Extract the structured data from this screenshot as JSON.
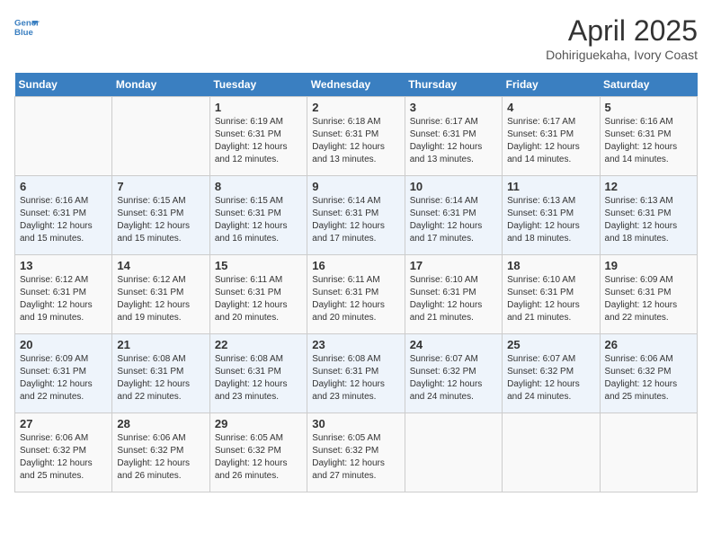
{
  "header": {
    "logo_line1": "General",
    "logo_line2": "Blue",
    "month_title": "April 2025",
    "subtitle": "Dohiriguekaha, Ivory Coast"
  },
  "days_of_week": [
    "Sunday",
    "Monday",
    "Tuesday",
    "Wednesday",
    "Thursday",
    "Friday",
    "Saturday"
  ],
  "weeks": [
    [
      {
        "num": "",
        "info": ""
      },
      {
        "num": "",
        "info": ""
      },
      {
        "num": "1",
        "info": "Sunrise: 6:19 AM\nSunset: 6:31 PM\nDaylight: 12 hours and 12 minutes."
      },
      {
        "num": "2",
        "info": "Sunrise: 6:18 AM\nSunset: 6:31 PM\nDaylight: 12 hours and 13 minutes."
      },
      {
        "num": "3",
        "info": "Sunrise: 6:17 AM\nSunset: 6:31 PM\nDaylight: 12 hours and 13 minutes."
      },
      {
        "num": "4",
        "info": "Sunrise: 6:17 AM\nSunset: 6:31 PM\nDaylight: 12 hours and 14 minutes."
      },
      {
        "num": "5",
        "info": "Sunrise: 6:16 AM\nSunset: 6:31 PM\nDaylight: 12 hours and 14 minutes."
      }
    ],
    [
      {
        "num": "6",
        "info": "Sunrise: 6:16 AM\nSunset: 6:31 PM\nDaylight: 12 hours and 15 minutes."
      },
      {
        "num": "7",
        "info": "Sunrise: 6:15 AM\nSunset: 6:31 PM\nDaylight: 12 hours and 15 minutes."
      },
      {
        "num": "8",
        "info": "Sunrise: 6:15 AM\nSunset: 6:31 PM\nDaylight: 12 hours and 16 minutes."
      },
      {
        "num": "9",
        "info": "Sunrise: 6:14 AM\nSunset: 6:31 PM\nDaylight: 12 hours and 17 minutes."
      },
      {
        "num": "10",
        "info": "Sunrise: 6:14 AM\nSunset: 6:31 PM\nDaylight: 12 hours and 17 minutes."
      },
      {
        "num": "11",
        "info": "Sunrise: 6:13 AM\nSunset: 6:31 PM\nDaylight: 12 hours and 18 minutes."
      },
      {
        "num": "12",
        "info": "Sunrise: 6:13 AM\nSunset: 6:31 PM\nDaylight: 12 hours and 18 minutes."
      }
    ],
    [
      {
        "num": "13",
        "info": "Sunrise: 6:12 AM\nSunset: 6:31 PM\nDaylight: 12 hours and 19 minutes."
      },
      {
        "num": "14",
        "info": "Sunrise: 6:12 AM\nSunset: 6:31 PM\nDaylight: 12 hours and 19 minutes."
      },
      {
        "num": "15",
        "info": "Sunrise: 6:11 AM\nSunset: 6:31 PM\nDaylight: 12 hours and 20 minutes."
      },
      {
        "num": "16",
        "info": "Sunrise: 6:11 AM\nSunset: 6:31 PM\nDaylight: 12 hours and 20 minutes."
      },
      {
        "num": "17",
        "info": "Sunrise: 6:10 AM\nSunset: 6:31 PM\nDaylight: 12 hours and 21 minutes."
      },
      {
        "num": "18",
        "info": "Sunrise: 6:10 AM\nSunset: 6:31 PM\nDaylight: 12 hours and 21 minutes."
      },
      {
        "num": "19",
        "info": "Sunrise: 6:09 AM\nSunset: 6:31 PM\nDaylight: 12 hours and 22 minutes."
      }
    ],
    [
      {
        "num": "20",
        "info": "Sunrise: 6:09 AM\nSunset: 6:31 PM\nDaylight: 12 hours and 22 minutes."
      },
      {
        "num": "21",
        "info": "Sunrise: 6:08 AM\nSunset: 6:31 PM\nDaylight: 12 hours and 22 minutes."
      },
      {
        "num": "22",
        "info": "Sunrise: 6:08 AM\nSunset: 6:31 PM\nDaylight: 12 hours and 23 minutes."
      },
      {
        "num": "23",
        "info": "Sunrise: 6:08 AM\nSunset: 6:31 PM\nDaylight: 12 hours and 23 minutes."
      },
      {
        "num": "24",
        "info": "Sunrise: 6:07 AM\nSunset: 6:32 PM\nDaylight: 12 hours and 24 minutes."
      },
      {
        "num": "25",
        "info": "Sunrise: 6:07 AM\nSunset: 6:32 PM\nDaylight: 12 hours and 24 minutes."
      },
      {
        "num": "26",
        "info": "Sunrise: 6:06 AM\nSunset: 6:32 PM\nDaylight: 12 hours and 25 minutes."
      }
    ],
    [
      {
        "num": "27",
        "info": "Sunrise: 6:06 AM\nSunset: 6:32 PM\nDaylight: 12 hours and 25 minutes."
      },
      {
        "num": "28",
        "info": "Sunrise: 6:06 AM\nSunset: 6:32 PM\nDaylight: 12 hours and 26 minutes."
      },
      {
        "num": "29",
        "info": "Sunrise: 6:05 AM\nSunset: 6:32 PM\nDaylight: 12 hours and 26 minutes."
      },
      {
        "num": "30",
        "info": "Sunrise: 6:05 AM\nSunset: 6:32 PM\nDaylight: 12 hours and 27 minutes."
      },
      {
        "num": "",
        "info": ""
      },
      {
        "num": "",
        "info": ""
      },
      {
        "num": "",
        "info": ""
      }
    ]
  ]
}
